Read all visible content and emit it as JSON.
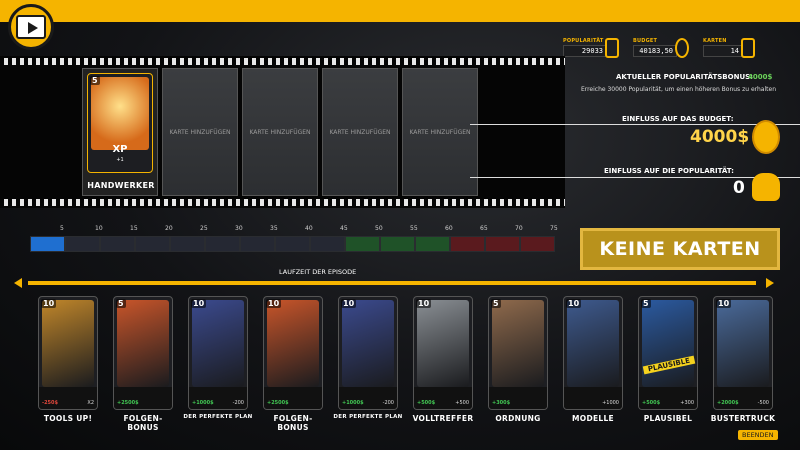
{
  "stats": [
    {
      "label": "POPULARITÄT",
      "value": "29033"
    },
    {
      "label": "BUDGET",
      "value": "40183,50"
    },
    {
      "label": "KARTEN",
      "value": "14"
    }
  ],
  "filmstrip": {
    "selected_card": {
      "cost": "5",
      "bonus": "XP",
      "bonus_sub": "+1",
      "name": "HANDWERKER"
    },
    "empty_label": "KARTE HINZUFÜGEN"
  },
  "info": {
    "pop_bonus_label": "AKTUELLER POPULARITÄTSBONUS:",
    "pop_bonus_value": "4000$",
    "pop_bonus_hint": "Erreiche 30000 Popularität, um einen höheren Bonus zu erhalten",
    "budget_label": "EINFLUSS AUF DAS BUDGET:",
    "budget_value": "4000$",
    "pop_label": "EINFLUSS AUF DIE POPULARITÄT:",
    "pop_value": "0"
  },
  "ruler_ticks": [
    "5",
    "10",
    "15",
    "20",
    "25",
    "30",
    "35",
    "40",
    "45",
    "50",
    "55",
    "60",
    "65",
    "70",
    "75"
  ],
  "ruler_segment_colors": [
    "#1f6fd0",
    "#252833",
    "#252833",
    "#252833",
    "#252833",
    "#252833",
    "#252833",
    "#252833",
    "#252833",
    "#1f5228",
    "#1f5228",
    "#1f5228",
    "#5a1a1e",
    "#5a1a1e",
    "#5a1a1e"
  ],
  "keine_karten": "KEINE KARTEN",
  "laufzeit_label": "LAUFZEIT DER EPISODE",
  "hand": [
    {
      "cost": "10",
      "left": "-250$",
      "right": "X2",
      "name": "TOOLS UP!",
      "art": "#c0862a",
      "left_dir": "dn"
    },
    {
      "cost": "5",
      "left": "+2500$",
      "right": "",
      "name": "FOLGEN-BONUS",
      "art": "#c8552a",
      "left_dir": "up"
    },
    {
      "cost": "10",
      "left": "+1000$",
      "right": "-200",
      "name": "DER PERFEKTE PLAN",
      "art": "#3b4a8e",
      "left_dir": "up"
    },
    {
      "cost": "10",
      "left": "+2500$",
      "right": "",
      "name": "FOLGEN-BONUS",
      "art": "#c8552a",
      "left_dir": "up"
    },
    {
      "cost": "10",
      "left": "+1000$",
      "right": "-200",
      "name": "DER PERFEKTE PLAN",
      "art": "#3b4a8e",
      "left_dir": "up"
    },
    {
      "cost": "10",
      "left": "+500$",
      "right": "+500",
      "name": "VOLLTREFFER",
      "art": "#8a8f94",
      "left_dir": "up"
    },
    {
      "cost": "5",
      "left": "+300$",
      "right": "",
      "name": "ORDNUNG",
      "art": "#8f6a4c",
      "left_dir": "up"
    },
    {
      "cost": "10",
      "left": "",
      "right": "+1000",
      "name": "MODELLE",
      "art": "#3e5a8e",
      "left_dir": "up"
    },
    {
      "cost": "5",
      "left": "+500$",
      "right": "+300",
      "name": "PLAUSIBEL",
      "art": "#2b5aa0",
      "left_dir": "up",
      "stamp": "PLAUSIBLE"
    },
    {
      "cost": "10",
      "left": "+2000$",
      "right": "-500",
      "name": "BUSTERTRUCK",
      "art": "#4a6a9a",
      "left_dir": "up"
    }
  ],
  "beenden": "BEENDEN"
}
